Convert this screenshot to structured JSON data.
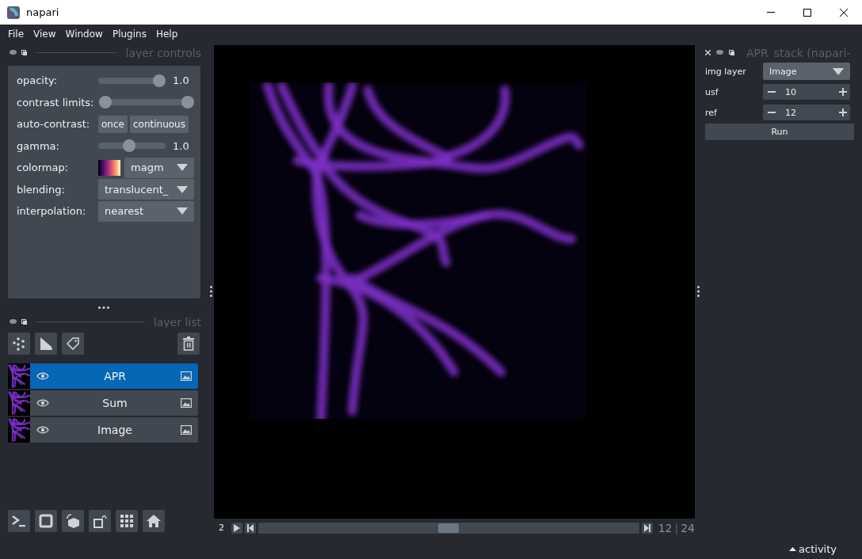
{
  "window": {
    "title": "napari"
  },
  "menu": [
    "File",
    "View",
    "Window",
    "Plugins",
    "Help"
  ],
  "layer_controls": {
    "title": "layer controls",
    "rows": [
      {
        "kind": "slider",
        "label": "opacity:",
        "level": 1,
        "reading": "1.0"
      },
      {
        "kind": "range",
        "label": "contrast limits:",
        "thumbs": [
          {
            "level": 0
          },
          {
            "level": 1
          }
        ]
      },
      {
        "kind": "buttons",
        "label": "auto-contrast:",
        "buttons": [
          "once",
          "continuous"
        ]
      },
      {
        "kind": "slider",
        "label": "gamma:",
        "level": 0.45,
        "reading": "1.0"
      },
      {
        "kind": "colormap",
        "label": "colormap:",
        "value": "magm"
      },
      {
        "kind": "dropdown",
        "label": "blending:",
        "value": "translucent_"
      },
      {
        "kind": "dropdown",
        "label": "interpolation:",
        "value": "nearest"
      }
    ]
  },
  "layer_list": {
    "title": "layer list",
    "layers": [
      {
        "name": "APR",
        "visible": true,
        "selected": true
      },
      {
        "name": "Sum",
        "visible": true,
        "selected": false
      },
      {
        "name": "Image",
        "visible": true,
        "selected": false
      }
    ]
  },
  "dims": {
    "axis": "2",
    "level": 0.5,
    "current": "12",
    "separator": "|",
    "total": "24"
  },
  "plugin": {
    "title": "APR_stack (napari-",
    "rows": [
      {
        "kind": "dropdown",
        "label": "img layer",
        "value": "Image"
      },
      {
        "kind": "spin",
        "label": "usf",
        "value": "10"
      },
      {
        "kind": "spin",
        "label": "ref",
        "value": "12"
      }
    ],
    "button": "Run"
  },
  "status": {
    "activity": "activity"
  }
}
